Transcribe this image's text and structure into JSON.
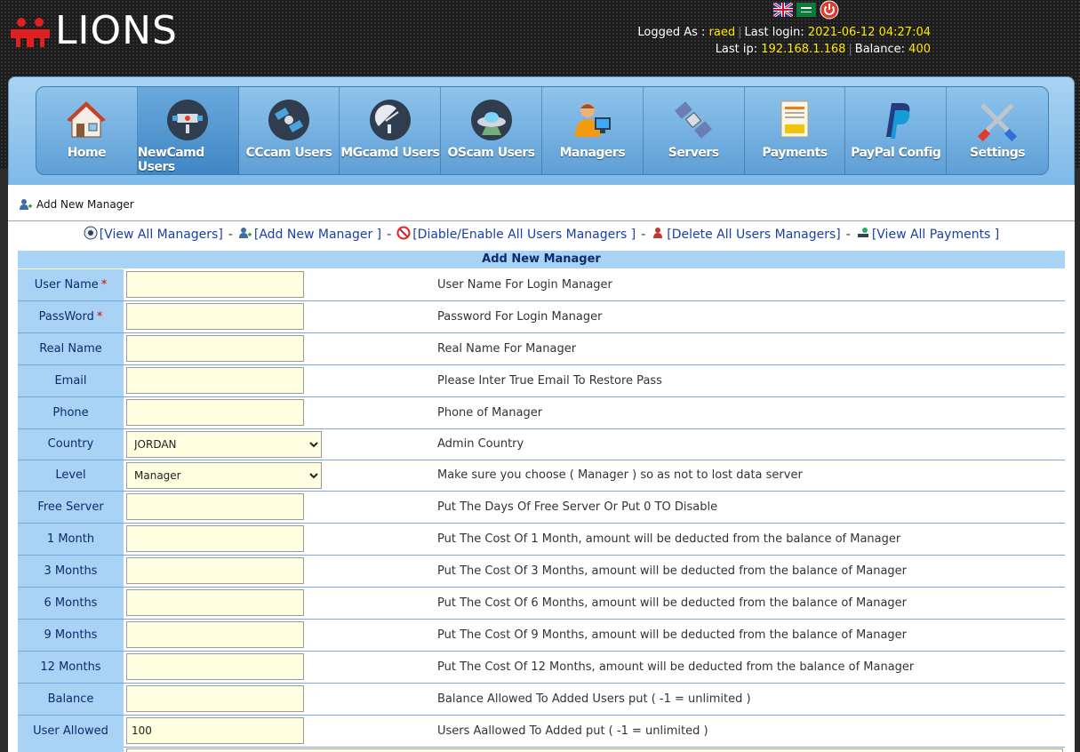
{
  "header": {
    "logo_text": "LIONS",
    "logged_as_label": "Logged As :",
    "logged_as_value": "raed",
    "last_login_label": "Last login:",
    "last_login_value": "2021-06-12 04:27:04",
    "last_ip_label": "Last ip:",
    "last_ip_value": "192.168.1.168",
    "balance_label": "Balance:",
    "balance_value": "400"
  },
  "nav": {
    "items": [
      {
        "label": "Home",
        "icon": "house-icon"
      },
      {
        "label": "NewCamd Users",
        "icon": "satellite-dish-icon",
        "active": true
      },
      {
        "label": "CCcam Users",
        "icon": "satellite-icon"
      },
      {
        "label": "MGcamd Users",
        "icon": "antenna-icon"
      },
      {
        "label": "OScam Users",
        "icon": "ufo-icon"
      },
      {
        "label": "Managers",
        "icon": "manager-icon"
      },
      {
        "label": "Servers",
        "icon": "server-satellite-icon"
      },
      {
        "label": "Payments",
        "icon": "payment-card-icon"
      },
      {
        "label": "PayPal Config",
        "icon": "paypal-icon"
      },
      {
        "label": "Settings",
        "icon": "tools-icon"
      }
    ]
  },
  "breadcrumb": "Add New Manager",
  "actions": {
    "view_all_managers": "[View All Managers]",
    "add_new_manager": "[Add New Manager ]",
    "disable_enable": "[Diable/Enable All Users Managers ]",
    "delete_all": "[Delete All Users Managers]",
    "view_all_payments": "[View All Payments ]"
  },
  "form": {
    "title": "Add New Manager",
    "rows": [
      {
        "label": "User Name",
        "required": "*",
        "value": "",
        "desc": "User Name For Login Manager"
      },
      {
        "label": "PassWord",
        "required": "*",
        "value": "",
        "desc": "Password For Login Manager"
      },
      {
        "label": "Real Name",
        "value": "",
        "desc": "Real Name For Manager"
      },
      {
        "label": "Email",
        "value": "",
        "desc": "Please Inter True Email To Restore Pass"
      },
      {
        "label": "Phone",
        "value": "",
        "desc": "Phone of Manager"
      },
      {
        "label": "Country",
        "value": "JORDAN",
        "desc": "Admin Country"
      },
      {
        "label": "Level",
        "value": "Manager",
        "desc": "Make sure you choose ( Manager ) so as not to lost data server"
      },
      {
        "label": "Free Server",
        "value": "",
        "desc": "Put The Days Of Free Server Or Put 0 TO Disable"
      },
      {
        "label": "1 Month",
        "value": "",
        "desc": "Put The Cost Of 1 Month, amount will be deducted from the balance of Manager"
      },
      {
        "label": "3 Months",
        "value": "",
        "desc": "Put The Cost Of 3 Months, amount will be deducted from the balance of Manager"
      },
      {
        "label": "6 Months",
        "value": "",
        "desc": "Put The Cost Of 6 Months, amount will be deducted from the balance of Manager"
      },
      {
        "label": "9 Months",
        "value": "",
        "desc": "Put The Cost Of 9 Months, amount will be deducted from the balance of Manager"
      },
      {
        "label": "12 Months",
        "value": "",
        "desc": "Put The Cost Of 12 Months, amount will be deducted from the balance of Manager"
      },
      {
        "label": "Balance",
        "value": "",
        "desc": "Balance Allowed To Added Users put ( -1 = unlimited )"
      },
      {
        "label": "User Allowed",
        "value": "100",
        "desc": "Users Aallowed To Added put ( -1 = unlimited )"
      }
    ]
  },
  "colors": {
    "accent_yellow": "#ffe600",
    "label_bg": "#a8d3f5",
    "input_bg": "#fffee0",
    "link": "#1b3fa8"
  }
}
